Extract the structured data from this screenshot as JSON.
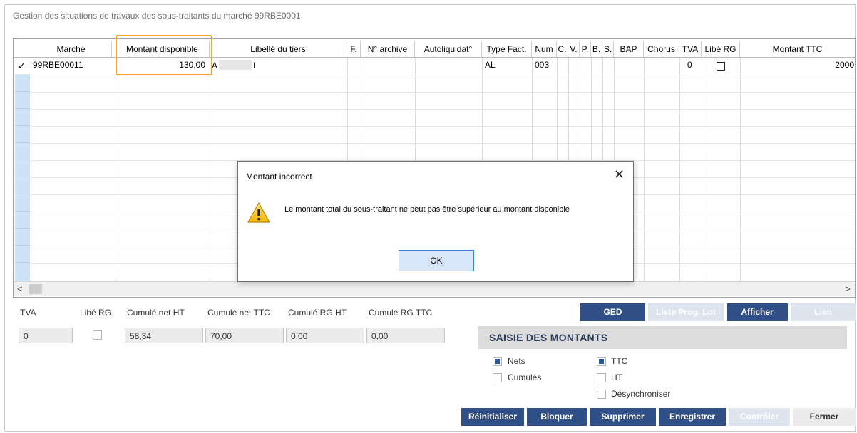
{
  "window": {
    "title": "Gestion des situations de travaux des sous-traitants du marché 99RBE0001"
  },
  "grid": {
    "columns": [
      "Marché",
      "Montant disponible",
      "Libellé du tiers",
      "F.",
      "N° archive",
      "Autoliquidat°",
      "Type Fact.",
      "Num",
      "C.",
      "V.",
      "P.",
      "B.",
      "S.",
      "BAP",
      "Chorus",
      "TVA",
      "Libé RG",
      "Montant TTC"
    ],
    "row1": {
      "marker": "✓",
      "marche": "99RBE00011",
      "montant_disponible": "130,00",
      "libelle_tiers": "A",
      "libelle_tiers_tail": "I",
      "type_fact": "AL",
      "num": "003",
      "tva": "0",
      "montant_ttc": "2000"
    },
    "scroll_left": "<",
    "scroll_right": ">"
  },
  "summary": {
    "labels": {
      "tva": "TVA",
      "libe_rg": "Libé RG",
      "cumule_net_ht": "Cumulé net HT",
      "cumule_net_ttc": "Cumulé net TTC",
      "cumule_rg_ht": "Cumulé RG HT",
      "cumule_rg_ttc": "Cumulé RG TTC"
    },
    "values": {
      "tva": "0",
      "cumule_net_ht": "58,34",
      "cumule_net_ttc": "70,00",
      "cumule_rg_ht": "0,00",
      "cumule_rg_ttc": "0,00"
    },
    "libe_rg_checked": false
  },
  "top_buttons": {
    "ged": "GED",
    "liste_prog_lot": "Liste Prog. Lot",
    "afficher": "Afficher",
    "lien": "Lien"
  },
  "saisie": {
    "title": "SAISIE DES MONTANTS",
    "nets": "Nets",
    "nets_checked": true,
    "cumules": "Cumulés",
    "cumules_checked": false,
    "ttc": "TTC",
    "ttc_checked": true,
    "ht": "HT",
    "ht_checked": false,
    "desynchroniser": "Désynchroniser",
    "desynchroniser_checked": false
  },
  "bottom_buttons": {
    "reinitialiser": "Réinitialiser",
    "bloquer": "Bloquer",
    "supprimer": "Supprimer",
    "enregistrer": "Enregistrer",
    "controler": "Contrôler",
    "fermer": "Fermer"
  },
  "dialog": {
    "title": "Montant incorrect",
    "message": "Le montant total du sous-traitant ne peut pas être supérieur au montant disponible",
    "ok_label": "OK",
    "close": "✕"
  },
  "colors": {
    "accent": "#2f4f86",
    "highlight": "#f4a42c",
    "row_header": "#cfe3f6"
  }
}
